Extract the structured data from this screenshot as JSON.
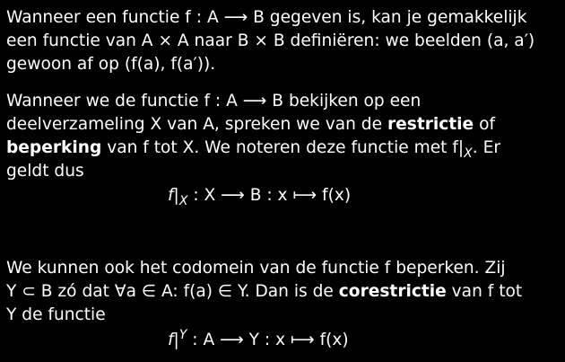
{
  "paragraph1": {
    "line1": "Wanneer een functie f : A ⟶ B gegeven is, kan je gemakkelijk",
    "line2": "een functie van A × A naar B × B definiëren: we beelden (a, a′)",
    "line3": "gewoon af op (f(a), f(a′))."
  },
  "paragraph2": {
    "line1": "Wanneer we de functie f : A ⟶ B bekijken op een",
    "line2_prefix": "deelverzameling X van A, spreken we van de ",
    "term_restrictie": "restrictie",
    "line2_suffix": " of",
    "term_beperking": "beperking",
    "line3_mid": " van f tot X. We noteren deze functie met f|",
    "line3_sub": "X",
    "line3_end": ". Er",
    "line4": "geldt dus"
  },
  "equation1": {
    "f": "f|",
    "sub": "X",
    "rest": " : X ⟶ B : x ⟼ f(x)"
  },
  "paragraph3": {
    "line1": "We kunnen ook het codomein van de functie f beperken. Zij",
    "line2_prefix": "Y ⊂ B zó dat ∀a ∈ A: f(a) ∈ Y. Dan is de ",
    "term_corestrictie": "corestrictie",
    "line2_suffix": " van f tot",
    "line3": "Y de functie"
  },
  "equation2": {
    "f": "f|",
    "sup": "Y",
    "rest": " : A ⟶ Y : x ⟼ f(x)"
  }
}
